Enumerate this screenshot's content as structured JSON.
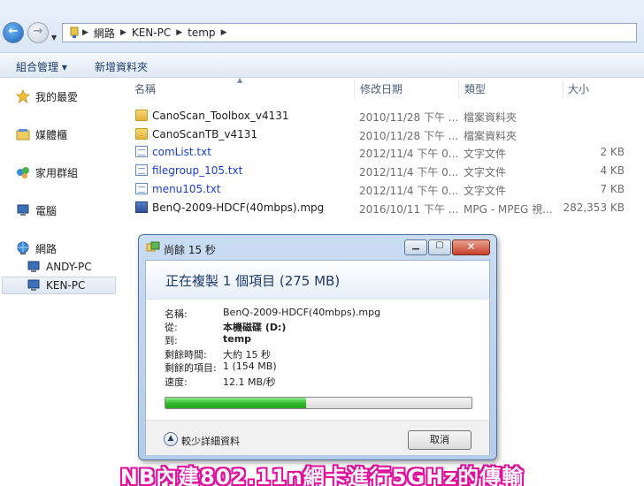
{
  "address": {
    "crumbs": [
      "網路",
      "KEN-PC",
      "temp"
    ]
  },
  "toolbar": {
    "organize_label": "組合管理 ▾",
    "new_folder_label": "新增資料夾"
  },
  "sidebar": {
    "items": [
      {
        "label": "我的最愛"
      },
      {
        "label": "媒體櫃"
      },
      {
        "label": "家用群組"
      },
      {
        "label": "電腦"
      },
      {
        "label": "網路"
      },
      {
        "label": "ANDY-PC"
      },
      {
        "label": "KEN-PC"
      }
    ]
  },
  "columns": {
    "name": "名稱",
    "modified": "修改日期",
    "type": "類型",
    "size": "大小"
  },
  "files": [
    {
      "name": "CanoScan_Toolbox_v4131",
      "date": "2010/11/28 下午 ...",
      "type": "檔案資料夾",
      "size": ""
    },
    {
      "name": "CanoScanTB_v4131",
      "date": "2010/11/28 下午 ...",
      "type": "檔案資料夾",
      "size": ""
    },
    {
      "name": "comList.txt",
      "date": "2012/11/4 下午 0...",
      "type": "文字文件",
      "size": "2 KB"
    },
    {
      "name": "filegroup_105.txt",
      "date": "2012/11/4 下午 0...",
      "type": "文字文件",
      "size": "4 KB"
    },
    {
      "name": "menu105.txt",
      "date": "2012/11/4 下午 0...",
      "type": "文字文件",
      "size": "7 KB"
    },
    {
      "name": "BenQ-2009-HDCF(40mbps).mpg",
      "date": "2016/10/11 下午 ...",
      "type": "MPG - MPEG 視...",
      "size": "282,353 KB"
    }
  ],
  "dialog": {
    "title": "尚餘 15 秒",
    "heading": "正在複製 1 個項目 (275 MB)",
    "rows": [
      {
        "label": "名稱:",
        "value": "BenQ-2009-HDCF(40mbps).mpg"
      },
      {
        "label": "從:",
        "value": "本機磁碟 (D:)"
      },
      {
        "label": "到:",
        "value": "temp"
      },
      {
        "label": "剩餘時間:",
        "value": "大約 15 秒"
      },
      {
        "label": "剩餘的項目:",
        "value": "1 (154 MB)"
      },
      {
        "label": "速度:",
        "value": "12.1 MB/秒"
      }
    ],
    "progress": 0.46,
    "less_details_label": "較少詳細資料",
    "cancel_label": "取消",
    "progress_color": "#2fb82a"
  },
  "caption": "NB內建802.11n網卡進行5GHz的傳輸"
}
